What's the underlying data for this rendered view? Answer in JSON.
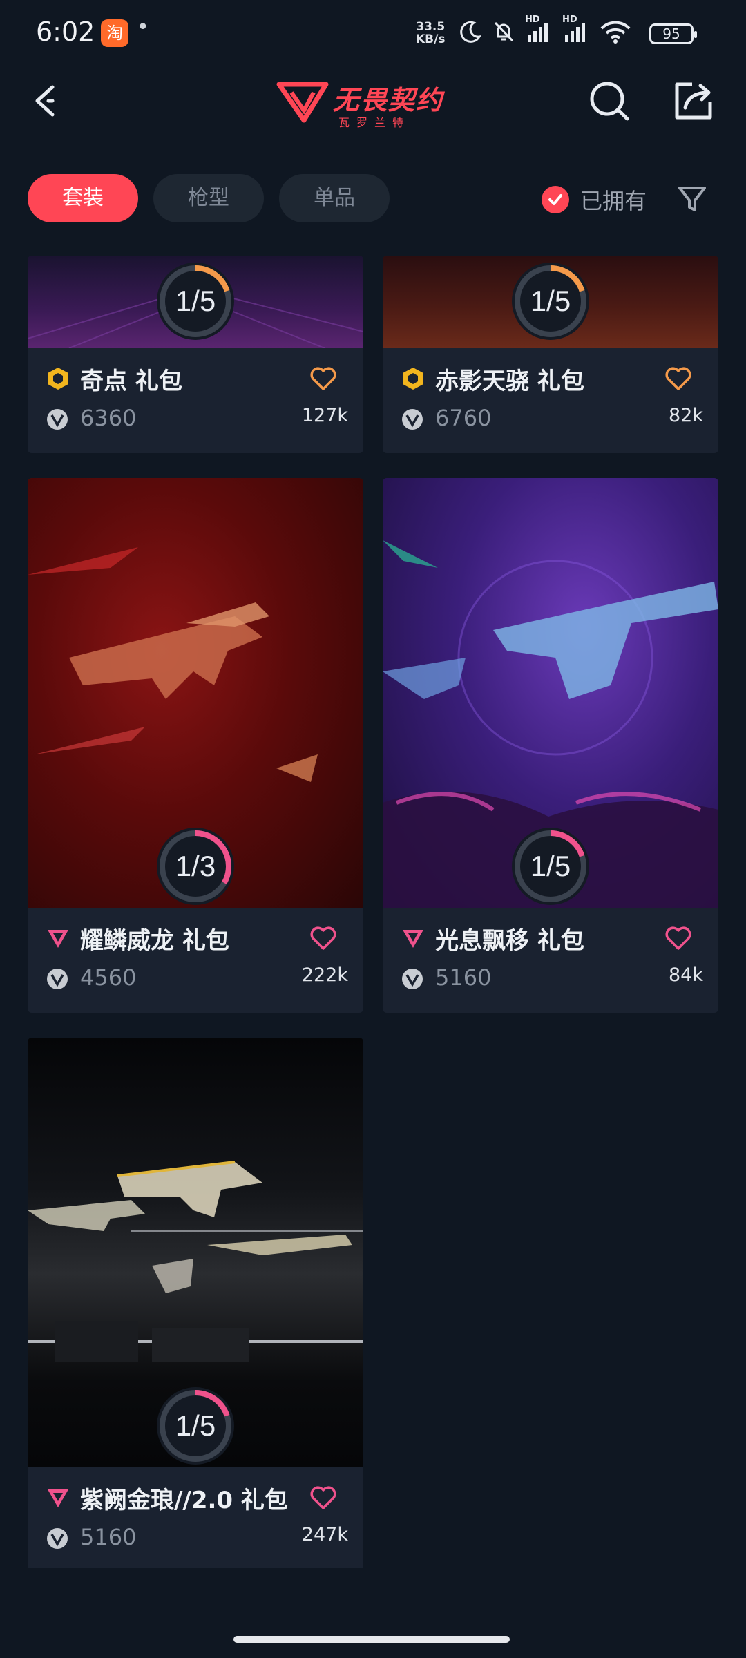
{
  "status_bar": {
    "time": "6:02",
    "app_icon_label": "淘",
    "dot": "•",
    "speed_value": "33.5",
    "speed_unit": "KB/s",
    "hd1": "HD",
    "hd2": "HD",
    "battery": "95"
  },
  "header": {
    "logo_title": "无畏契约",
    "logo_subtitle": "瓦罗兰特",
    "icons": [
      "back-icon",
      "search-icon",
      "share-icon"
    ]
  },
  "tabs": [
    {
      "label": "套装",
      "active": true
    },
    {
      "label": "枪型",
      "active": false
    },
    {
      "label": "单品",
      "active": false
    }
  ],
  "owned_filter": {
    "label": "已拥有",
    "checked": true
  },
  "colors": {
    "accent": "#ff4655",
    "background": "#0f1722",
    "card": "#1a2230",
    "gold_tier": "#f2b51e",
    "pink_tier": "#f0528c",
    "orange_heart": "#f59a4a",
    "pink_heart": "#f0528c"
  },
  "cards": [
    {
      "title": "奇点 礼包",
      "progress": "1/5",
      "progress_fraction": 0.2,
      "price": "6360",
      "likes": "127k",
      "tier": "gold",
      "heart": "orange"
    },
    {
      "title": "赤影天骁 礼包",
      "progress": "1/5",
      "progress_fraction": 0.2,
      "price": "6760",
      "likes": "82k",
      "tier": "gold",
      "heart": "orange"
    },
    {
      "title": "耀鳞威龙 礼包",
      "progress": "1/3",
      "progress_fraction": 0.333,
      "price": "4560",
      "likes": "222k",
      "tier": "pink",
      "heart": "pink"
    },
    {
      "title": "光息飘移 礼包",
      "progress": "1/5",
      "progress_fraction": 0.2,
      "price": "5160",
      "likes": "84k",
      "tier": "pink",
      "heart": "pink"
    },
    {
      "title": "紫阙金琅//2.0 礼包",
      "progress": "1/5",
      "progress_fraction": 0.2,
      "price": "5160",
      "likes": "247k",
      "tier": "pink",
      "heart": "pink"
    }
  ]
}
